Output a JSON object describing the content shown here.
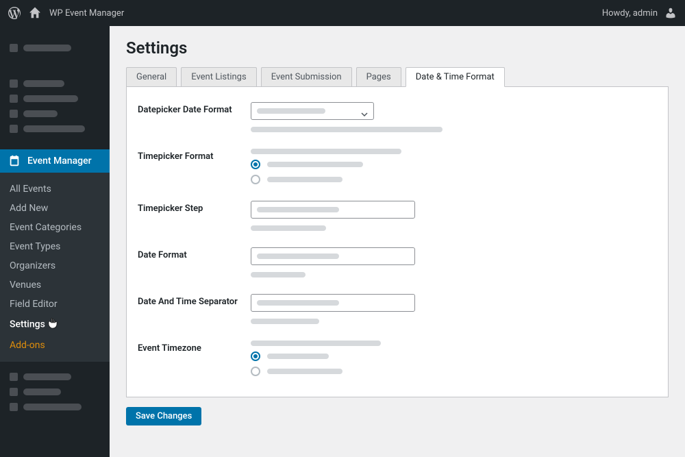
{
  "toolbar": {
    "site_title": "WP Event Manager",
    "howdy": "Howdy, admin"
  },
  "sidebar": {
    "active_label": "Event Manager",
    "submenu": [
      {
        "label": "All Events",
        "current": false,
        "orange": false
      },
      {
        "label": "Add New",
        "current": false,
        "orange": false
      },
      {
        "label": "Event Categories",
        "current": false,
        "orange": false
      },
      {
        "label": "Event Types",
        "current": false,
        "orange": false
      },
      {
        "label": "Organizers",
        "current": false,
        "orange": false
      },
      {
        "label": "Venues",
        "current": false,
        "orange": false
      },
      {
        "label": "Field Editor",
        "current": false,
        "orange": false
      },
      {
        "label": "Settings",
        "current": true,
        "orange": false,
        "cursor": true
      },
      {
        "label": "Add-ons",
        "current": false,
        "orange": true
      }
    ]
  },
  "page": {
    "title": "Settings",
    "tabs": [
      {
        "label": "General",
        "active": false
      },
      {
        "label": "Event Listings",
        "active": false
      },
      {
        "label": "Event Submission",
        "active": false
      },
      {
        "label": "Pages",
        "active": false
      },
      {
        "label": "Date & Time Format",
        "active": true
      }
    ],
    "fields": {
      "datepicker": "Datepicker Date Format",
      "timepicker_format": "Timepicker Format",
      "timepicker_step": "Timepicker Step",
      "date_format": "Date Format",
      "date_time_separator": "Date And Time Separator",
      "event_timezone": "Event Timezone"
    },
    "save_label": "Save Changes"
  }
}
